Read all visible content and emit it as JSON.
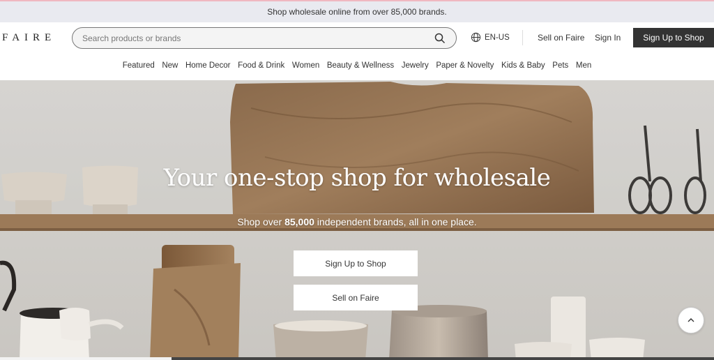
{
  "announcement": "Shop wholesale online from over 85,000 brands.",
  "header": {
    "logo": "FAIRE",
    "search_placeholder": "Search products or brands",
    "language": "EN-US",
    "sell_link": "Sell on Faire",
    "sign_in": "Sign In",
    "signup_button": "Sign Up to Shop"
  },
  "nav": [
    "Featured",
    "New",
    "Home Decor",
    "Food & Drink",
    "Women",
    "Beauty & Wellness",
    "Jewelry",
    "Paper & Novelty",
    "Kids & Baby",
    "Pets",
    "Men"
  ],
  "hero": {
    "title": "Your one-stop shop for wholesale",
    "subtitle_pre": "Shop over ",
    "subtitle_bold": "85,000",
    "subtitle_post": " independent brands, all in one place.",
    "primary_button": "Sign Up to Shop",
    "secondary_button": "Sell on Faire",
    "carousel_progress": 0.24
  },
  "icons": {
    "search": "search-icon",
    "globe": "globe-icon",
    "scroll_top": "chevron-up-icon"
  }
}
